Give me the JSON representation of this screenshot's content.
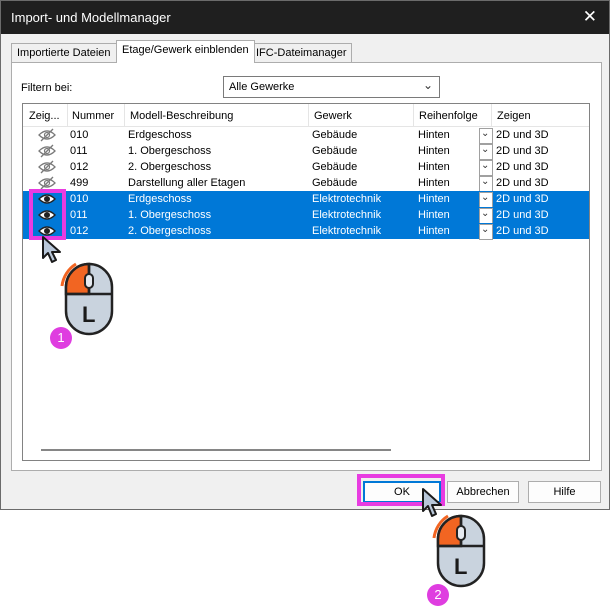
{
  "window": {
    "title": "Import- und Modellmanager",
    "close_glyph": "✕"
  },
  "tabs": [
    {
      "label": "Importierte Dateien"
    },
    {
      "label": "Etage/Gewerk einblenden"
    },
    {
      "label": "IFC-Dateimanager"
    }
  ],
  "filter": {
    "label": "Filtern bei:",
    "value": "Alle Gewerke"
  },
  "columns": [
    "Zeig...",
    "Nummer",
    "Modell-Beschreibung",
    "Gewerk",
    "Reihenfolge",
    "Zeigen"
  ],
  "rows": [
    {
      "visible": "hidden-eye-icon",
      "nummer": "010",
      "beschreibung": "Erdgeschoss",
      "gewerk": "Gebäude",
      "reihenfolge": "Hinten",
      "zeigen": "2D und 3D",
      "selected": false
    },
    {
      "visible": "hidden-eye-icon",
      "nummer": "011",
      "beschreibung": "1. Obergeschoss",
      "gewerk": "Gebäude",
      "reihenfolge": "Hinten",
      "zeigen": "2D und 3D",
      "selected": false
    },
    {
      "visible": "hidden-eye-icon",
      "nummer": "012",
      "beschreibung": "2. Obergeschoss",
      "gewerk": "Gebäude",
      "reihenfolge": "Hinten",
      "zeigen": "2D und 3D",
      "selected": false
    },
    {
      "visible": "hidden-eye-icon",
      "nummer": "499",
      "beschreibung": "Darstellung aller Etagen",
      "gewerk": "Gebäude",
      "reihenfolge": "Hinten",
      "zeigen": "2D und 3D",
      "selected": false
    },
    {
      "visible": "eye-icon",
      "nummer": "010",
      "beschreibung": "Erdgeschoss",
      "gewerk": "Elektrotechnik",
      "reihenfolge": "Hinten",
      "zeigen": "2D und 3D",
      "selected": true
    },
    {
      "visible": "eye-icon",
      "nummer": "011",
      "beschreibung": "1. Obergeschoss",
      "gewerk": "Elektrotechnik",
      "reihenfolge": "Hinten",
      "zeigen": "2D und 3D",
      "selected": true
    },
    {
      "visible": "eye-icon",
      "nummer": "012",
      "beschreibung": "2. Obergeschoss",
      "gewerk": "Elektrotechnik",
      "reihenfolge": "Hinten",
      "zeigen": "2D und 3D",
      "selected": true
    }
  ],
  "buttons": {
    "ok": "OK",
    "cancel": "Abbrechen",
    "help": "Hilfe"
  },
  "annotations": {
    "step1": "1",
    "step2": "2",
    "mouse_letter": "L"
  },
  "colors": {
    "selection": "#0078d7",
    "highlight": "#e83ce1",
    "badge": "#df3de0",
    "mouse_button": "#f26522"
  }
}
